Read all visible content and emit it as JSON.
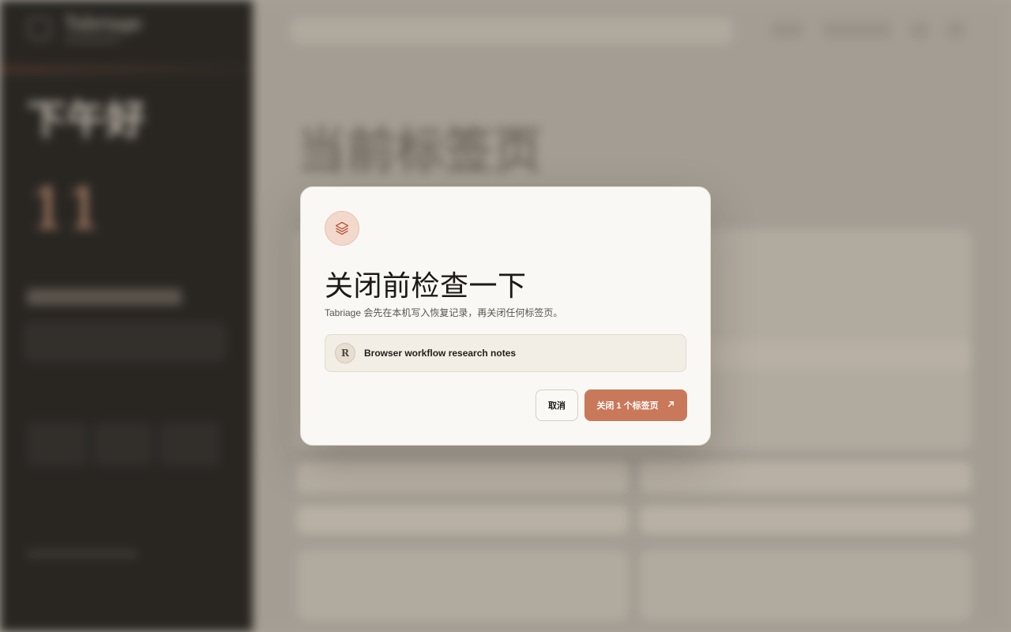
{
  "background": {
    "brand": "Tabriage",
    "greeting": "下午好",
    "tab_count": "11",
    "page_title": "当前标签页"
  },
  "dialog": {
    "title": "关闭前检查一下",
    "description": "Tabriage 会先在本机写入恢复记录，再关闭任何标签页。",
    "icon": "layers-icon",
    "tabs": [
      {
        "avatar_letter": "R",
        "title": "Browser workflow research notes"
      }
    ],
    "cancel_label": "取消",
    "confirm_label": "关闭 1 个标签页",
    "confirm_icon": "arrow-up-right-icon"
  },
  "colors": {
    "accent": "#c9785a",
    "dialog_bg": "#faf8f4",
    "sidebar_bg": "#1e1c1a"
  }
}
